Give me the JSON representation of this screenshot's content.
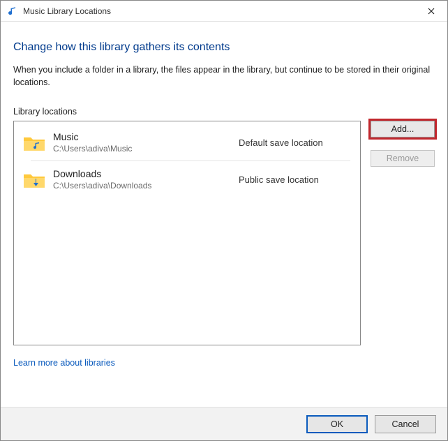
{
  "titlebar": {
    "title": "Music Library Locations"
  },
  "heading": "Change how this library gathers its contents",
  "description": "When you include a folder in a library, the files appear in the library, but continue to be stored in their original locations.",
  "section_label": "Library locations",
  "locations": [
    {
      "name": "Music",
      "path": "C:\\Users\\adiva\\Music",
      "tag": "Default save location"
    },
    {
      "name": "Downloads",
      "path": "C:\\Users\\adiva\\Downloads",
      "tag": "Public save location"
    }
  ],
  "buttons": {
    "add": "Add...",
    "remove": "Remove",
    "ok": "OK",
    "cancel": "Cancel"
  },
  "link": "Learn more about libraries"
}
